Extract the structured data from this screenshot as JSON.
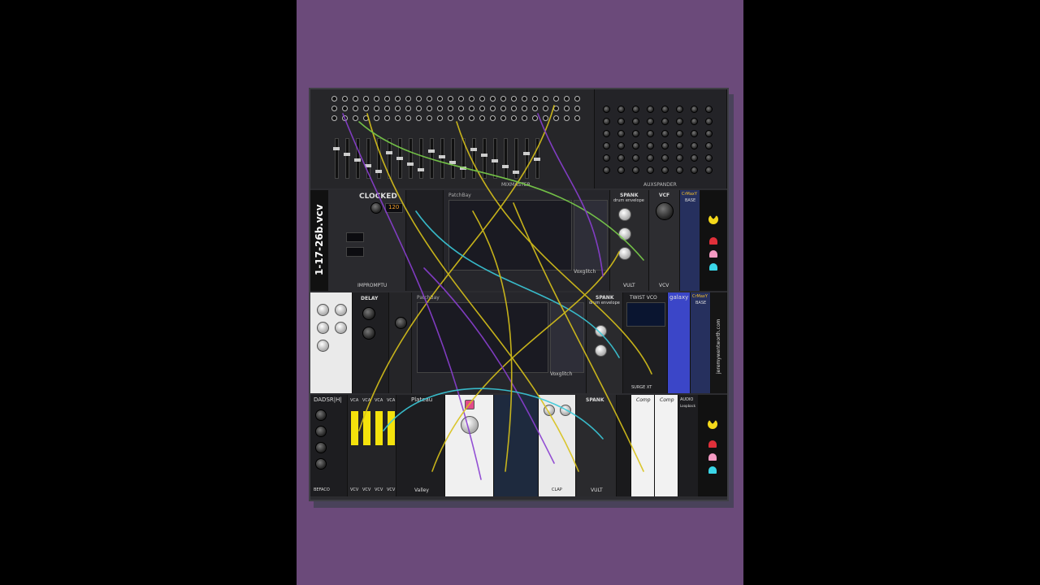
{
  "rack": {
    "patch_name": "1-17-26b.vcv",
    "row1": {
      "mixmaster_label": "MIXMASTER",
      "auxspander_label": "AUXSPANDER"
    },
    "row2": {
      "clocked_title": "CLOCKED",
      "clocked_bpm": "120",
      "impromptu_label": "IMPROMPTU",
      "patchbay_title": "PatchBay",
      "voxglitch_label": "Voxglitch",
      "spank_title": "SPANK",
      "spank_subtitle": "drum envelope",
      "vcf_label": "VCF",
      "vult_label": "VULT",
      "vcv_label": "VCV",
      "crmaxy_label": "CrMaxY",
      "base_label": "BASE"
    },
    "row3": {
      "delay_title": "DELAY",
      "patchbay_title": "PatchBay",
      "voxglitch_label": "Voxglitch",
      "spank_title": "SPANK",
      "spank_subtitle": "drum envelope",
      "twist_vco_title": "TWIST VCO",
      "surge_label": "SURGE XT",
      "galaxy_title": "galaxy",
      "crmaxy_label": "CrMaxY",
      "base_label": "BASE",
      "author_url": "jeremywentworth.com"
    },
    "row4": {
      "dadsrh_title": "DADSR|H|",
      "befaco_label": "BEFACO",
      "vca_label": "VCA",
      "vcv_label": "VCV",
      "plateau_title": "Plateau",
      "valley_label": "Valley",
      "spank_title": "SPANK",
      "clap_label": "CLAP",
      "vult_label": "VULT",
      "comp_label": "Comp",
      "audio_title": "AUDIO",
      "audio_sub": "Loopback"
    }
  },
  "colors": {
    "background_left": "#000000",
    "stage": "#6b4a7a",
    "rack": "#2c2c30",
    "vca_meter": "#f4e20c",
    "cable_yellow": "#d8c21a",
    "cable_purple": "#8a3fd1",
    "cable_cyan": "#3ac9d9",
    "cable_green": "#7bd04a"
  }
}
